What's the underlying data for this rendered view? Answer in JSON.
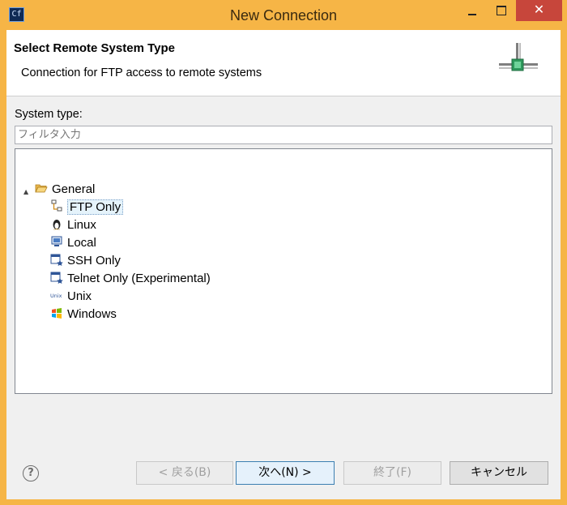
{
  "window": {
    "title": "New Connection",
    "app_icon_text": "Cf",
    "close_glyph": "✕"
  },
  "header": {
    "title": "Select Remote System Type",
    "description": "Connection for FTP access to remote systems"
  },
  "system_type": {
    "label": "System type:",
    "filter_placeholder": "フィルタ入力"
  },
  "tree": {
    "category": {
      "label": "General",
      "expanded": true,
      "icon": "folder-open-icon"
    },
    "items": [
      {
        "label": "FTP Only",
        "icon": "ftp-icon",
        "selected": true
      },
      {
        "label": "Linux",
        "icon": "linux-penguin-icon",
        "selected": false
      },
      {
        "label": "Local",
        "icon": "local-computer-icon",
        "selected": false
      },
      {
        "label": "SSH Only",
        "icon": "ssh-terminal-icon",
        "selected": false
      },
      {
        "label": "Telnet Only (Experimental)",
        "icon": "telnet-terminal-icon",
        "selected": false
      },
      {
        "label": "Unix",
        "icon": "unix-icon",
        "selected": false
      },
      {
        "label": "Windows",
        "icon": "windows-logo-icon",
        "selected": false
      }
    ]
  },
  "buttons": {
    "help": "?",
    "back": "< 戻る(B)",
    "next": "次へ(N) >",
    "finish": "終了(F)",
    "cancel": "キャンセル"
  },
  "colors": {
    "window_frame": "#f6b546",
    "close_button": "#c7463b",
    "selection": "#e5f3fb"
  }
}
